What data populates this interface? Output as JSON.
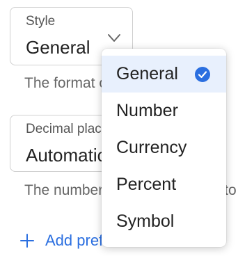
{
  "style_field": {
    "label": "Style",
    "value": "General",
    "help_text": "The format of the value"
  },
  "decimal_field": {
    "label": "Decimal places",
    "value": "Automatic",
    "help_text": "The number of decimal places to show"
  },
  "add_link": {
    "label": "Add prefix"
  },
  "style_menu": {
    "items": [
      {
        "label": "General",
        "selected": true
      },
      {
        "label": "Number",
        "selected": false
      },
      {
        "label": "Currency",
        "selected": false
      },
      {
        "label": "Percent",
        "selected": false
      },
      {
        "label": "Symbol",
        "selected": false
      }
    ]
  },
  "colors": {
    "accent": "#2b6fe0",
    "selected_bg": "#e8f0fd",
    "border": "#cfcfcf"
  },
  "icons": {
    "chevron": "chevron-down-icon",
    "check": "check-circle-icon",
    "plus": "plus-icon"
  }
}
